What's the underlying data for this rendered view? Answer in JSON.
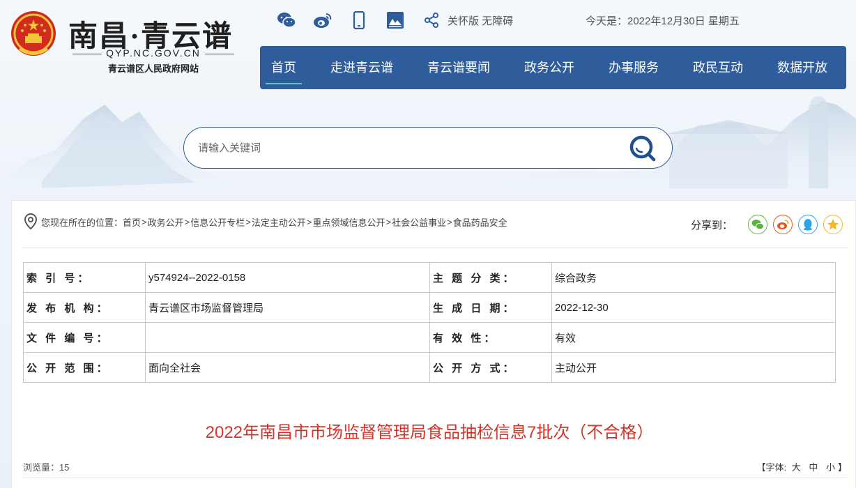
{
  "header": {
    "site_name": "南昌·青云谱",
    "domain": "QYP.NC.GOV.CN",
    "subtitle": "青云谱区人民政府网站",
    "top_icons": [
      "wechat-icon",
      "weibo-icon",
      "mobile-icon",
      "app-icon",
      "share-icon"
    ],
    "care_label": "关怀版 无障碍",
    "date_label": "今天是：2022年12月30日 星期五"
  },
  "nav": {
    "items": [
      {
        "label": "首页",
        "active": true
      },
      {
        "label": "走进青云谱"
      },
      {
        "label": "青云谱要闻"
      },
      {
        "label": "政务公开"
      },
      {
        "label": "办事服务"
      },
      {
        "label": "政民互动"
      },
      {
        "label": "数据开放"
      }
    ]
  },
  "search": {
    "placeholder": "请输入关键词",
    "icon": "search-icon"
  },
  "breadcrumb": {
    "prefix": "您现在所在的位置：",
    "items": [
      "首页",
      "政务公开",
      "信息公开专栏",
      "法定主动公开",
      "重点领域信息公开",
      "社会公益事业",
      "食品药品安全"
    ],
    "separator": ">"
  },
  "share": {
    "label": "分享到：",
    "targets": [
      {
        "icon": "wechat-icon",
        "color": "#5bb53b"
      },
      {
        "icon": "weibo-icon",
        "color": "#e8541e"
      },
      {
        "icon": "qq-icon",
        "color": "#2aa5e4"
      },
      {
        "icon": "qzone-icon",
        "color": "#f0b72b"
      }
    ]
  },
  "meta": {
    "rows": [
      [
        {
          "k": "索 引 号：",
          "v": "y574924--2022-0158"
        },
        {
          "k": "主 题 分 类：",
          "v": "综合政务"
        }
      ],
      [
        {
          "k": "发 布 机 构：",
          "v": "青云谱区市场监督管理局"
        },
        {
          "k": "生 成 日 期：",
          "v": "2022-12-30"
        }
      ],
      [
        {
          "k": "文 件 编 号：",
          "v": ""
        },
        {
          "k": "有 效 性：",
          "v": "有效"
        }
      ],
      [
        {
          "k": "公 开 范 围：",
          "v": "面向全社会"
        },
        {
          "k": "公 开 方 式：",
          "v": "主动公开"
        }
      ]
    ]
  },
  "article": {
    "title": "2022年南昌市市场监督管理局食品抽检信息7批次（不合格）",
    "views_label": "浏览量：",
    "views": "15",
    "font_label": "【字体:",
    "font_options": [
      "大",
      "中",
      "小"
    ],
    "font_end": "】"
  },
  "colors": {
    "nav_bg": "#2f5d9c",
    "title_red": "#d2352b",
    "nav_active_underline": "#5ec6c6"
  }
}
